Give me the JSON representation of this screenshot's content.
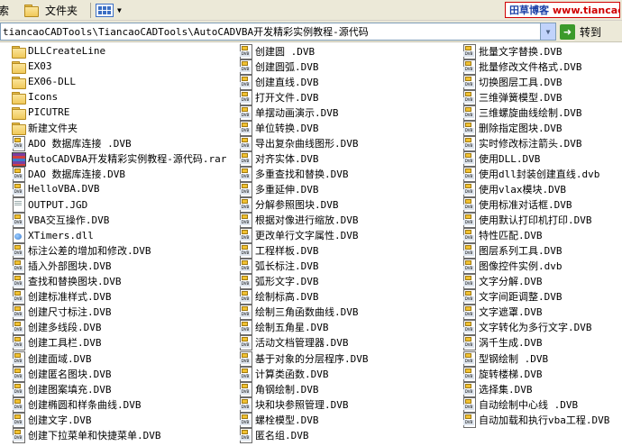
{
  "toolbar": {
    "search_label": "搜索",
    "folders_label": "文件夹",
    "view_menu_icon": "views-icon",
    "brand_name": "田草博客",
    "brand_url": "www.tiancao.net"
  },
  "address": {
    "path": "tiancaoCADTools\\TiancaoCADTools\\AutoCADVBA开发精彩实例教程-源代码",
    "go_label": "转到"
  },
  "files": {
    "column1": [
      {
        "name": "DLLCreateLine",
        "icon": "folder-icon"
      },
      {
        "name": "EX03",
        "icon": "folder-icon"
      },
      {
        "name": "EX06-DLL",
        "icon": "folder-icon"
      },
      {
        "name": "Icons",
        "icon": "folder-icon"
      },
      {
        "name": "PICUTRE",
        "icon": "folder-icon"
      },
      {
        "name": "新建文件夹",
        "icon": "folder-icon"
      },
      {
        "name": "ADO 数据库连接 .DVB",
        "icon": "dvb-icon"
      },
      {
        "name": "AutoCADVBA开发精彩实例教程-源代码.rar",
        "icon": "rar-icon"
      },
      {
        "name": "DAO 数据库连接.DVB",
        "icon": "dvb-icon"
      },
      {
        "name": "HelloVBA.DVB",
        "icon": "dvb-icon"
      },
      {
        "name": "OUTPUT.JGD",
        "icon": "doc-icon"
      },
      {
        "name": "VBA交互操作.DVB",
        "icon": "dvb-icon"
      },
      {
        "name": "XTimers.dll",
        "icon": "dll-icon"
      },
      {
        "name": "标注公差的增加和修改.DVB",
        "icon": "dvb-icon"
      },
      {
        "name": "插入外部图块.DVB",
        "icon": "dvb-icon"
      },
      {
        "name": "查找和替换图块.DVB",
        "icon": "dvb-icon"
      },
      {
        "name": "创建标准样式.DVB",
        "icon": "dvb-icon"
      },
      {
        "name": "创建尺寸标注.DVB",
        "icon": "dvb-icon"
      },
      {
        "name": "创建多线段.DVB",
        "icon": "dvb-icon"
      },
      {
        "name": "创建工具栏.DVB",
        "icon": "dvb-icon"
      },
      {
        "name": "创建面域.DVB",
        "icon": "dvb-icon"
      },
      {
        "name": "创建匿名图块.DVB",
        "icon": "dvb-icon"
      },
      {
        "name": "创建图案填充.DVB",
        "icon": "dvb-icon"
      },
      {
        "name": "创建椭圆和样条曲线.DVB",
        "icon": "dvb-icon"
      },
      {
        "name": "创建文字.DVB",
        "icon": "dvb-icon"
      },
      {
        "name": "创建下拉菜单和快捷菜单.DVB",
        "icon": "dvb-icon"
      }
    ],
    "column2": [
      {
        "name": "创建圆 .DVB",
        "icon": "dvb-icon"
      },
      {
        "name": "创建圆弧.DVB",
        "icon": "dvb-icon"
      },
      {
        "name": "创建直线.DVB",
        "icon": "dvb-icon"
      },
      {
        "name": "打开文件.DVB",
        "icon": "dvb-icon"
      },
      {
        "name": "单摆动画演示.DVB",
        "icon": "dvb-icon"
      },
      {
        "name": "单位转换.DVB",
        "icon": "dvb-icon"
      },
      {
        "name": "导出复杂曲线图形.DVB",
        "icon": "dvb-icon"
      },
      {
        "name": "对齐实体.DVB",
        "icon": "dvb-icon"
      },
      {
        "name": "多重查找和替换.DVB",
        "icon": "dvb-icon"
      },
      {
        "name": "多重延伸.DVB",
        "icon": "dvb-icon"
      },
      {
        "name": "分解参照图块.DVB",
        "icon": "dvb-icon"
      },
      {
        "name": "根据对像进行缩放.DVB",
        "icon": "dvb-icon"
      },
      {
        "name": "更改单行文字属性.DVB",
        "icon": "dvb-icon"
      },
      {
        "name": "工程样板.DVB",
        "icon": "dvb-icon"
      },
      {
        "name": "弧长标注.DVB",
        "icon": "dvb-icon"
      },
      {
        "name": "弧形文字.DVB",
        "icon": "dvb-icon"
      },
      {
        "name": "绘制标高.DVB",
        "icon": "dvb-icon"
      },
      {
        "name": "绘制三角函数曲线.DVB",
        "icon": "dvb-icon"
      },
      {
        "name": "绘制五角星.DVB",
        "icon": "dvb-icon"
      },
      {
        "name": "活动文档管理器.DVB",
        "icon": "dvb-icon"
      },
      {
        "name": "基于对象的分层程序.DVB",
        "icon": "dvb-icon"
      },
      {
        "name": "计算类函数.DVB",
        "icon": "dvb-icon"
      },
      {
        "name": "角钢绘制.DVB",
        "icon": "dvb-icon"
      },
      {
        "name": "块和块参照管理.DVB",
        "icon": "dvb-icon"
      },
      {
        "name": "螺栓模型.DVB",
        "icon": "dvb-icon"
      },
      {
        "name": "匿名组.DVB",
        "icon": "dvb-icon"
      }
    ],
    "column3": [
      {
        "name": "批量文字替换.DVB",
        "icon": "dvb-icon"
      },
      {
        "name": "批量修改文件格式.DVB",
        "icon": "dvb-icon"
      },
      {
        "name": "切换图层工具.DVB",
        "icon": "dvb-icon"
      },
      {
        "name": "三维弹簧模型.DVB",
        "icon": "dvb-icon"
      },
      {
        "name": "三维螺旋曲线绘制.DVB",
        "icon": "dvb-icon"
      },
      {
        "name": "删除指定图块.DVB",
        "icon": "dvb-icon"
      },
      {
        "name": "实时修改标注箭头.DVB",
        "icon": "dvb-icon"
      },
      {
        "name": "使用DLL.DVB",
        "icon": "dvb-icon"
      },
      {
        "name": "使用dll封装创建直线.dvb",
        "icon": "dvb-icon"
      },
      {
        "name": "使用vlax模块.DVB",
        "icon": "dvb-icon"
      },
      {
        "name": "使用标准对话框.DVB",
        "icon": "dvb-icon"
      },
      {
        "name": "使用默认打印机打印.DVB",
        "icon": "dvb-icon"
      },
      {
        "name": "特性匹配.DVB",
        "icon": "dvb-icon"
      },
      {
        "name": "图层系列工具.DVB",
        "icon": "dvb-icon"
      },
      {
        "name": "图像控件实例.dvb",
        "icon": "dvb-icon"
      },
      {
        "name": "文字分解.DVB",
        "icon": "dvb-icon"
      },
      {
        "name": "文字间距调整.DVB",
        "icon": "dvb-icon"
      },
      {
        "name": "文字遮罩.DVB",
        "icon": "dvb-icon"
      },
      {
        "name": "文字转化为多行文字.DVB",
        "icon": "dvb-icon"
      },
      {
        "name": "涡千生成.DVB",
        "icon": "dvb-icon"
      },
      {
        "name": "型钢绘制 .DVB",
        "icon": "dvb-icon"
      },
      {
        "name": "旋转楼梯.DVB",
        "icon": "dvb-icon"
      },
      {
        "name": "选择集.DVB",
        "icon": "dvb-icon"
      },
      {
        "name": "自动绘制中心线 .DVB",
        "icon": "dvb-icon"
      },
      {
        "name": "自动加载和执行vba工程.DVB",
        "icon": "dvb-icon"
      }
    ]
  }
}
